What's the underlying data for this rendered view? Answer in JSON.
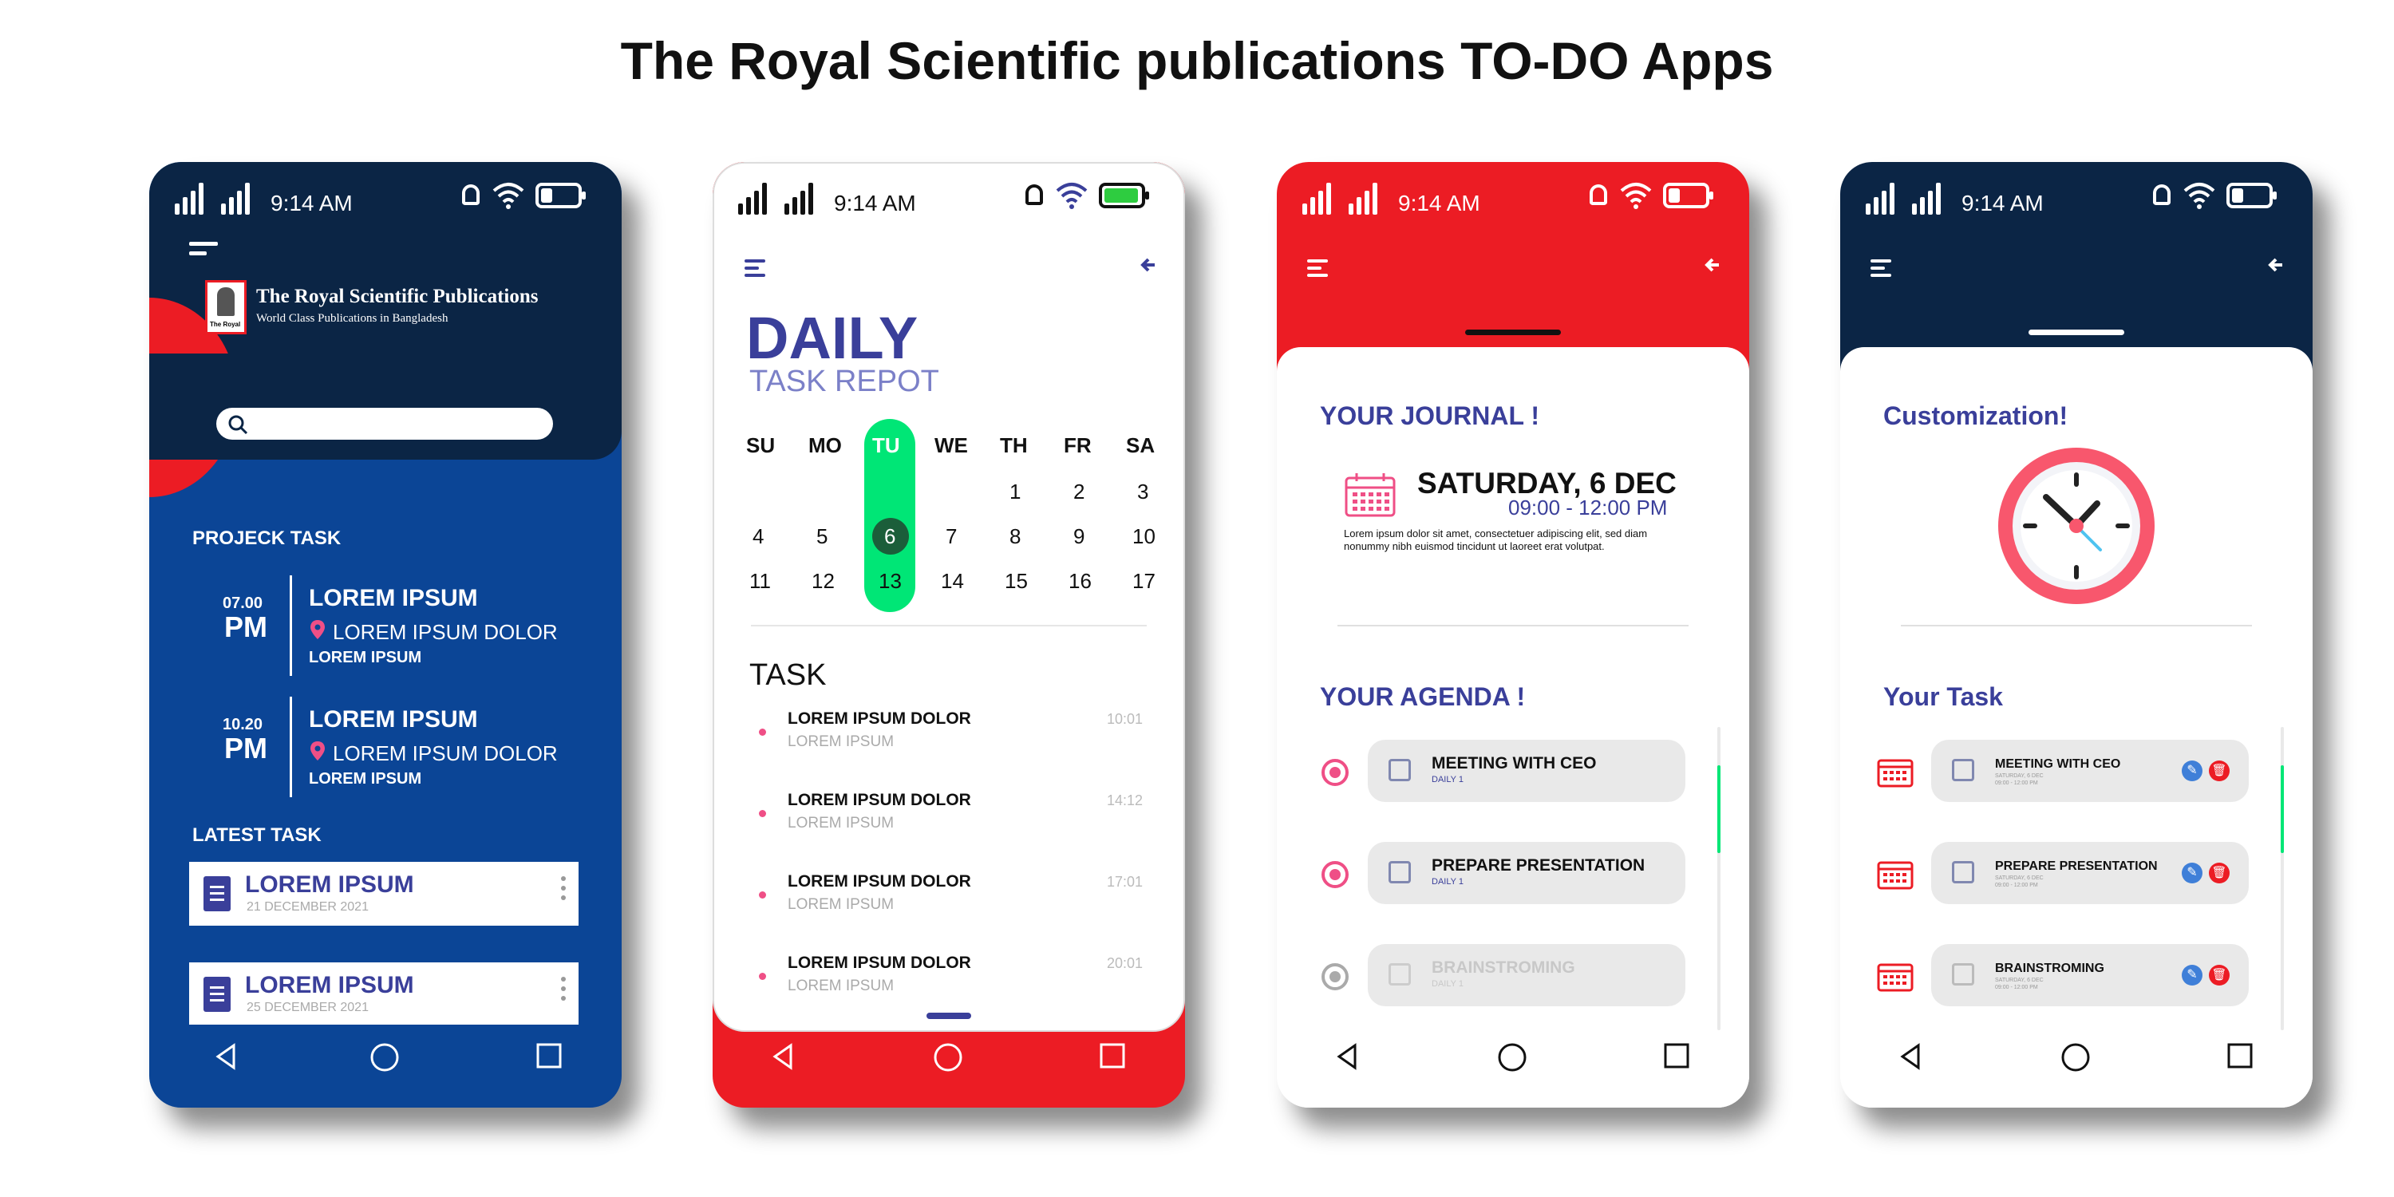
{
  "title": "The Royal Scientific publications TO-DO Apps",
  "status_time": "9:14 AM",
  "phone1": {
    "brand_name": "The Royal Scientific Publications",
    "brand_tagline": "World Class Publications in Bangladesh",
    "logo_text": "The Royal",
    "search_placeholder": "",
    "project_heading": "PROJECK TASK",
    "projects": [
      {
        "hour": "07.00",
        "ampm": "PM",
        "title": "LOREM IPSUM",
        "location": "LOREM IPSUM DOLOR",
        "sub": "LOREM IPSUM"
      },
      {
        "hour": "10.20",
        "ampm": "PM",
        "title": "LOREM IPSUM",
        "location": "LOREM IPSUM DOLOR",
        "sub": "LOREM IPSUM"
      }
    ],
    "latest_heading": "LATEST TASK",
    "latest": [
      {
        "title": "LOREM IPSUM",
        "date": "21 DECEMBER 2021"
      },
      {
        "title": "LOREM IPSUM",
        "date": "25 DECEMBER 2021"
      }
    ]
  },
  "phone2": {
    "heading": "DAILY",
    "subheading": "TASK REPOT",
    "weekdays": [
      "SU",
      "MO",
      "TU",
      "WE",
      "TH",
      "FR",
      "SA"
    ],
    "week1": [
      "",
      "",
      "",
      "",
      "1",
      "2",
      "3"
    ],
    "week2": [
      "4",
      "5",
      "6",
      "7",
      "8",
      "9",
      "10"
    ],
    "week3": [
      "11",
      "12",
      "13",
      "14",
      "15",
      "16",
      "17"
    ],
    "task_heading": "TASK",
    "tasks": [
      {
        "title": "LOREM IPSUM DOLOR",
        "sub": "LOREM IPSUM",
        "time": "10:01"
      },
      {
        "title": "LOREM IPSUM DOLOR",
        "sub": "LOREM IPSUM",
        "time": "14:12"
      },
      {
        "title": "LOREM IPSUM DOLOR",
        "sub": "LOREM IPSUM",
        "time": "17:01"
      },
      {
        "title": "LOREM IPSUM DOLOR",
        "sub": "LOREM IPSUM",
        "time": "20:01"
      }
    ]
  },
  "phone3": {
    "journal_heading": "YOUR JOURNAL !",
    "date": "SATURDAY, 6 DEC",
    "time_range": "09:00 - 12:00 PM",
    "description_line1": "Lorem ipsum dolor sit amet, consectetuer adipiscing elit, sed diam",
    "description_line2": "nonummy nibh euismod tincidunt ut laoreet  erat volutpat.",
    "agenda_heading": "YOUR AGENDA !",
    "agenda": [
      {
        "title": "MEETING WITH CEO",
        "sub": "DAILY 1"
      },
      {
        "title": "PREPARE PRESENTATION",
        "sub": "DAILY 1"
      },
      {
        "title": "BRAINSTROMING",
        "sub": "DAILY 1"
      }
    ]
  },
  "phone4": {
    "custom_heading": "Customization!",
    "task_heading": "Your Task",
    "tasks": [
      {
        "title": "MEETING WITH CEO",
        "sub1": "SATURDAY, 6 DEC",
        "sub2": "09:00 - 12:00 PM"
      },
      {
        "title": "PREPARE PRESENTATION",
        "sub1": "SATURDAY, 6 DEC",
        "sub2": "09:00 - 12:00 PM"
      },
      {
        "title": "BRAINSTROMING",
        "sub1": "SATURDAY, 6 DEC",
        "sub2": "09:00 - 12:00 PM"
      }
    ]
  },
  "colors": {
    "navy": "#0b2545",
    "blue": "#0b4596",
    "red": "#ec1c24",
    "green": "#00e676",
    "indigo": "#3a3f9a",
    "pink": "#ef4f86",
    "gray_card": "#e9e9e9"
  },
  "icons": [
    "signal-icon",
    "bell-icon",
    "wifi-icon",
    "battery-icon",
    "menu-icon",
    "back-arrow-icon",
    "search-icon",
    "location-pin-icon",
    "document-icon",
    "more-icon",
    "calendar-icon",
    "clock-icon",
    "edit-icon",
    "delete-icon",
    "nav-back-icon",
    "nav-home-icon",
    "nav-recent-icon"
  ]
}
